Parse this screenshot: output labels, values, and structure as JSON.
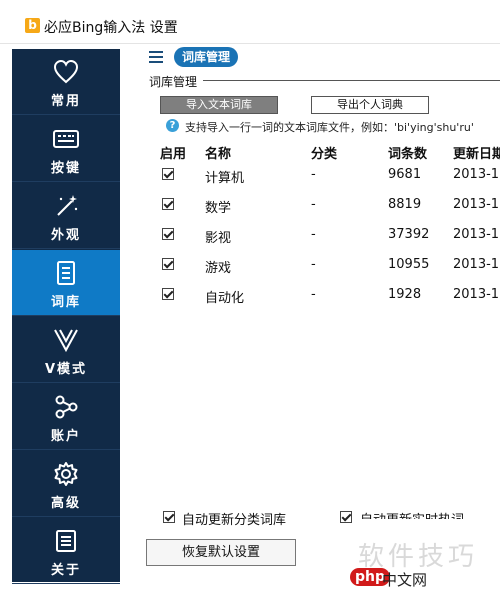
{
  "window": {
    "logo": "b",
    "title": "必应Bing输入法 设置"
  },
  "sidebar": {
    "items": [
      {
        "label": "常用",
        "icon": "heart-icon"
      },
      {
        "label": "按键",
        "icon": "keyboard-icon"
      },
      {
        "label": "外观",
        "icon": "magic-wand-icon"
      },
      {
        "label": "词库",
        "icon": "book-icon"
      },
      {
        "label": "V模式",
        "icon": "v-mode-icon"
      },
      {
        "label": "账户",
        "icon": "share-nodes-icon"
      },
      {
        "label": "高级",
        "icon": "gear-icon"
      },
      {
        "label": "关于",
        "icon": "document-icon"
      }
    ],
    "active_index": 3,
    "colors": {
      "background": "#112a47",
      "active": "#0f7ac6"
    }
  },
  "header": {
    "page_title": "词库管理"
  },
  "group": {
    "title": "词库管理",
    "import_button": "导入文本词库",
    "export_button": "导出个人词典",
    "hint": "支持导入一行一词的文本词库文件，例如：'bi'ying'shu'ru'"
  },
  "table": {
    "headers": {
      "enable": "启用",
      "name": "名称",
      "category": "分类",
      "count": "词条数",
      "date": "更新日期"
    },
    "rows": [
      {
        "enabled": true,
        "name": "计算机",
        "category": "-",
        "count": "9681",
        "date": "2013-1"
      },
      {
        "enabled": true,
        "name": "数学",
        "category": "-",
        "count": "8819",
        "date": "2013-1"
      },
      {
        "enabled": true,
        "name": "影视",
        "category": "-",
        "count": "37392",
        "date": "2013-1"
      },
      {
        "enabled": true,
        "name": "游戏",
        "category": "-",
        "count": "10955",
        "date": "2013-1"
      },
      {
        "enabled": true,
        "name": "自动化",
        "category": "-",
        "count": "1928",
        "date": "2013-1"
      }
    ]
  },
  "options": {
    "auto_update_category": "自动更新分类词库",
    "auto_update_hot": "自动更新实时热词"
  },
  "reset_button": "恢复默认设置",
  "watermark": {
    "text": "软件技巧",
    "logo": "php",
    "site": "中文网"
  }
}
